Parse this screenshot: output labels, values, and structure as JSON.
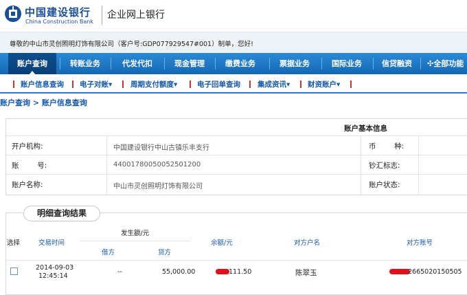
{
  "brand": {
    "name_cn": "中国建设银行",
    "name_en": "China Construction Bank",
    "product": "企业网上银行",
    "color": "#1a4f97"
  },
  "welcome_text": "尊敬的中山市灵创照明灯饰有限公司（客户号:GDP077929547#001）制单，您好!",
  "nav": {
    "items": [
      "账户查询",
      "转账业务",
      "代发代扣",
      "现金管理",
      "缴费业务",
      "票据业务",
      "国际业务",
      "信贷融资",
      "全部功能"
    ],
    "active": "账户查询"
  },
  "subnav": {
    "items": [
      "账户信息查询",
      "电子对账",
      "周期支付额度",
      "电子回单查询",
      "集成资讯",
      "财资账户"
    ]
  },
  "breadcrumb": {
    "root": "账户查询",
    "separator": ">",
    "current": "账户信息查询"
  },
  "account_info": {
    "title": "账户基本信息",
    "bank_label": "开户机构:",
    "bank_value": "中国建设银行中山古镇乐丰支行",
    "number_label": "账        号:",
    "number_value": "44001780050052501200",
    "name_label": "账户名称:",
    "name_value": "中山市灵创照明灯饰有限公司",
    "currency_label": "币        种:",
    "cash_label": "钞汇标志:",
    "status_label": "账户状态:"
  },
  "detail": {
    "title": "明细查询结果",
    "headers": {
      "select": "选择",
      "time": "交易时间",
      "amount_group": "发生额/元",
      "debit": "借方",
      "credit": "贷方",
      "balance": "余额/元",
      "counterparty_name": "对方户名",
      "counterparty_account": "对方账号"
    },
    "rows": [
      {
        "date": "2014-09-03",
        "time": "12:45:14",
        "debit": "--",
        "credit": "55,000.00",
        "balance_visible": "111.50",
        "counterparty_name": "陈翠玉",
        "counterparty_account_visible": "2665020150505"
      }
    ]
  }
}
